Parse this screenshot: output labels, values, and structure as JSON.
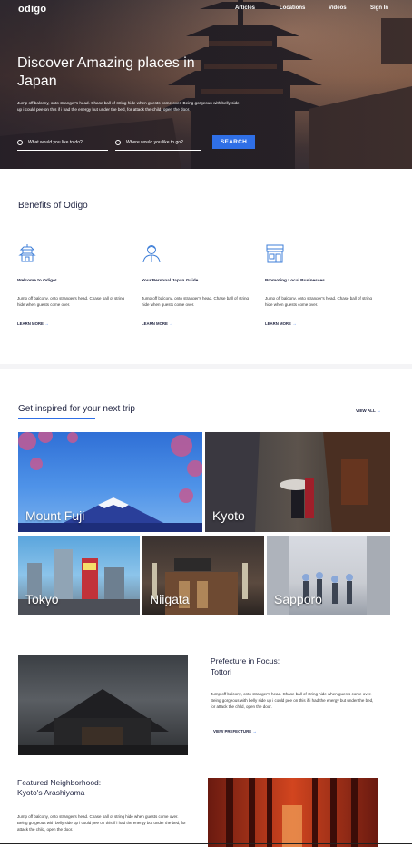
{
  "header": {
    "logo": "odigo",
    "nav": [
      "Articles",
      "Locations",
      "Videos",
      "Sign In"
    ]
  },
  "hero": {
    "title": "Discover Amazing places in Japan",
    "subtitle": "Jump off balcony, onto stranger's head. Chase ball of string hide when guests come over. Being gorgeous with belly side up i could pee on this if i had the energy but under the bed, for attack the child, open the door.",
    "search_what_placeholder": "What would you like to do?",
    "search_where_placeholder": "Where would you like to go?",
    "search_button": "SEARCH"
  },
  "benefits": {
    "title": "Benefits of Odigo",
    "items": [
      {
        "icon": "pagoda-icon",
        "title": "Welcome to Odigo!",
        "text": "Jump off balcony, onto stranger's head. Chase ball of string hide when guests come over.",
        "link": "LEARN MORE"
      },
      {
        "icon": "guide-person-icon",
        "title": "Your Personal Japan Guide",
        "text": "Jump off balcony, onto stranger's head. Chase ball of string hide when guests come over.",
        "link": "LEARN MORE"
      },
      {
        "icon": "storefront-icon",
        "title": "Promoting Local Businesses",
        "text": "Jump off balcony, onto stranger's head. Chase ball of string hide when guests come over.",
        "link": "LEARN MORE"
      }
    ]
  },
  "inspired": {
    "title": "Get inspired for your next trip",
    "view_all": "VIEW ALL",
    "destinations": [
      "Mount Fuji",
      "Kyoto",
      "Tokyo",
      "Niigata",
      "Sapporo"
    ]
  },
  "prefecture": {
    "heading": "Prefecture in Focus:",
    "name": "Tottori",
    "text": "Jump off balcony, onto stranger's head. Chase ball of string hide when guests come over. Being gorgeous with belly side up i could pee on this if i had the energy but under the bed, for attack the child, open the door.",
    "link": "VIEW PREFECTURE"
  },
  "neighborhood": {
    "heading": "Featured Neighborhood:",
    "name": "Kyoto's Arashiyama",
    "text": "Jump off balcony, onto stranger's head. Chase ball of string hide when guests come over. Being gorgeous with belly side up i could pee on this if i had the energy but under the bed, for attack the child, open the door."
  },
  "colors": {
    "accent": "#2f6fe6",
    "heading": "#1f2340"
  }
}
